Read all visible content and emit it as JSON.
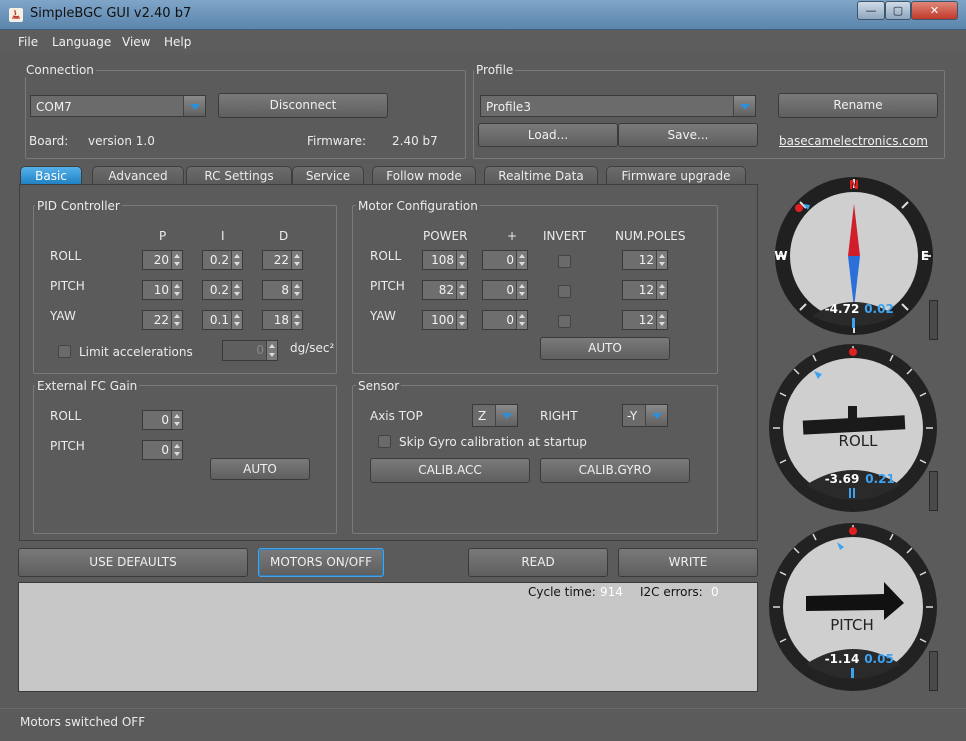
{
  "window": {
    "title": "SimpleBGC GUI v2.40 b7",
    "min_glyph": "—",
    "max_glyph": "▢",
    "close_glyph": "✕"
  },
  "menu": [
    "File",
    "Language",
    "View",
    "Help"
  ],
  "connection": {
    "label": "Connection",
    "port": "COM7",
    "disconnect": "Disconnect",
    "board_label": "Board:",
    "board_value": "version 1.0",
    "firmware_label": "Firmware:",
    "firmware_value": "2.40 b7"
  },
  "profile": {
    "label": "Profile",
    "selected": "Profile3",
    "rename": "Rename",
    "load": "Load...",
    "save": "Save...",
    "link": "basecamelectronics.com"
  },
  "tabs": [
    "Basic",
    "Advanced",
    "RC Settings",
    "Service",
    "Follow mode",
    "Realtime Data",
    "Firmware upgrade"
  ],
  "pid": {
    "label": "PID Controller",
    "headers": [
      "P",
      "I",
      "D"
    ],
    "rows": [
      {
        "name": "ROLL",
        "p": "20",
        "i": "0.2",
        "d": "22"
      },
      {
        "name": "PITCH",
        "p": "10",
        "i": "0.2",
        "d": "8"
      },
      {
        "name": "YAW",
        "p": "22",
        "i": "0.1",
        "d": "18"
      }
    ],
    "limit_label": "Limit accelerations",
    "limit_value": "0",
    "limit_unit": "dg/sec²"
  },
  "motor": {
    "label": "Motor Configuration",
    "headers": [
      "POWER",
      "+",
      "INVERT",
      "NUM.POLES"
    ],
    "rows": [
      {
        "name": "ROLL",
        "power": "108",
        "offset": "0",
        "poles": "12"
      },
      {
        "name": "PITCH",
        "power": "82",
        "offset": "0",
        "poles": "12"
      },
      {
        "name": "YAW",
        "power": "100",
        "offset": "0",
        "poles": "12"
      }
    ],
    "auto": "AUTO"
  },
  "extfc": {
    "label": "External FC Gain",
    "rows": [
      {
        "name": "ROLL",
        "value": "0"
      },
      {
        "name": "PITCH",
        "value": "0"
      }
    ],
    "auto": "AUTO"
  },
  "sensor": {
    "label": "Sensor",
    "axis_top_label": "Axis TOP",
    "axis_top": "Z",
    "right_label": "RIGHT",
    "right": "-Y",
    "skip_gyro": "Skip Gyro calibration at startup",
    "calib_acc": "CALIB.ACC",
    "calib_gyro": "CALIB.GYRO"
  },
  "actions": {
    "defaults": "USE DEFAULTS",
    "motors": "MOTORS ON/OFF",
    "read": "READ",
    "write": "WRITE"
  },
  "log": {
    "cycle_label": "Cycle time:",
    "cycle_value": "914",
    "i2c_label": "I2C errors:",
    "i2c_value": "0"
  },
  "status": "Motors switched OFF",
  "gauges": {
    "yaw": {
      "angle": "-4.72",
      "rate": "0.02",
      "cardinals": {
        "n": "N",
        "e": "E",
        "w": "W"
      }
    },
    "roll": {
      "label": "ROLL",
      "angle": "-3.69",
      "rate": "0.21"
    },
    "pitch": {
      "label": "PITCH",
      "angle": "-1.14",
      "rate": "0.05"
    }
  },
  "colors": {
    "accent": "#2b8fd9",
    "tab_active": "#1d7fc2",
    "rate_text": "#3da3f0",
    "marker_red": "#e02020"
  }
}
